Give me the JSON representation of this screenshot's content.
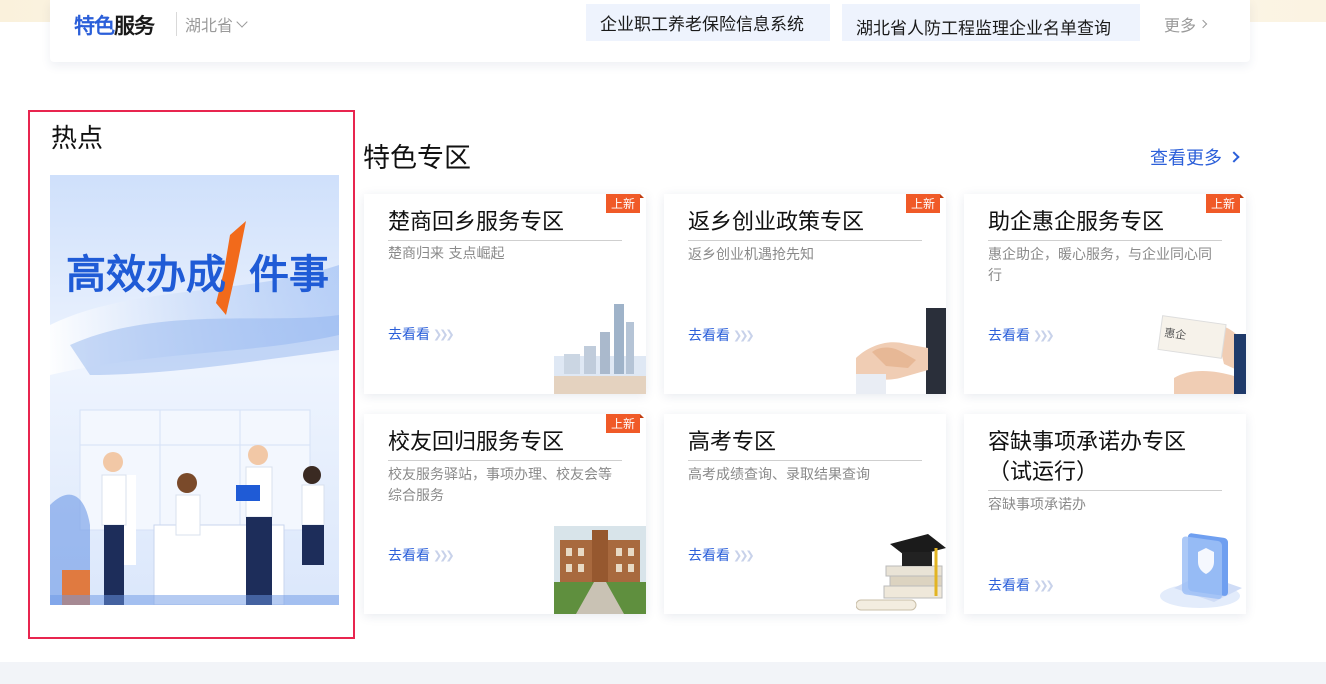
{
  "service_bar": {
    "brand_part1": "特色",
    "brand_part2": "服务",
    "province": "湖北省",
    "links": [
      "企业职工养老保险信息系统",
      "湖北省人防工程监理企业名单查询"
    ],
    "more": "更多"
  },
  "hot": {
    "title": "热点",
    "banner_text_left": "高效办成",
    "banner_text_right": "件事"
  },
  "zones": {
    "title": "特色专区",
    "view_more": "查看更多",
    "go_label": "去看看",
    "new_badge": "上新",
    "cards": [
      {
        "title": "楚商回乡服务专区",
        "desc": "楚商归来 支点崛起",
        "is_new": true,
        "image": "city-skyline-icon"
      },
      {
        "title": "返乡创业政策专区",
        "desc": "返乡创业机遇抢先知",
        "is_new": true,
        "image": "handshake-icon"
      },
      {
        "title": "助企惠企服务专区",
        "desc": "惠企助企，暖心服务，与企业同心同行",
        "is_new": true,
        "image": "business-card-icon"
      },
      {
        "title": "校友回归服务专区",
        "desc": "校友服务驿站，事项办理、校友会等综合服务",
        "is_new": true,
        "image": "university-building-icon"
      },
      {
        "title": "高考专区",
        "desc": "高考成绩查询、录取结果查询",
        "is_new": false,
        "image": "graduation-cap-icon"
      },
      {
        "title": "容缺事项承诺办专区（试运行）",
        "desc": "容缺事项承诺办",
        "is_new": false,
        "image": "shield-document-icon"
      }
    ]
  },
  "colors": {
    "accent": "#2b5fd9",
    "badge": "#f05a28",
    "highlight_border": "#e8254f"
  }
}
